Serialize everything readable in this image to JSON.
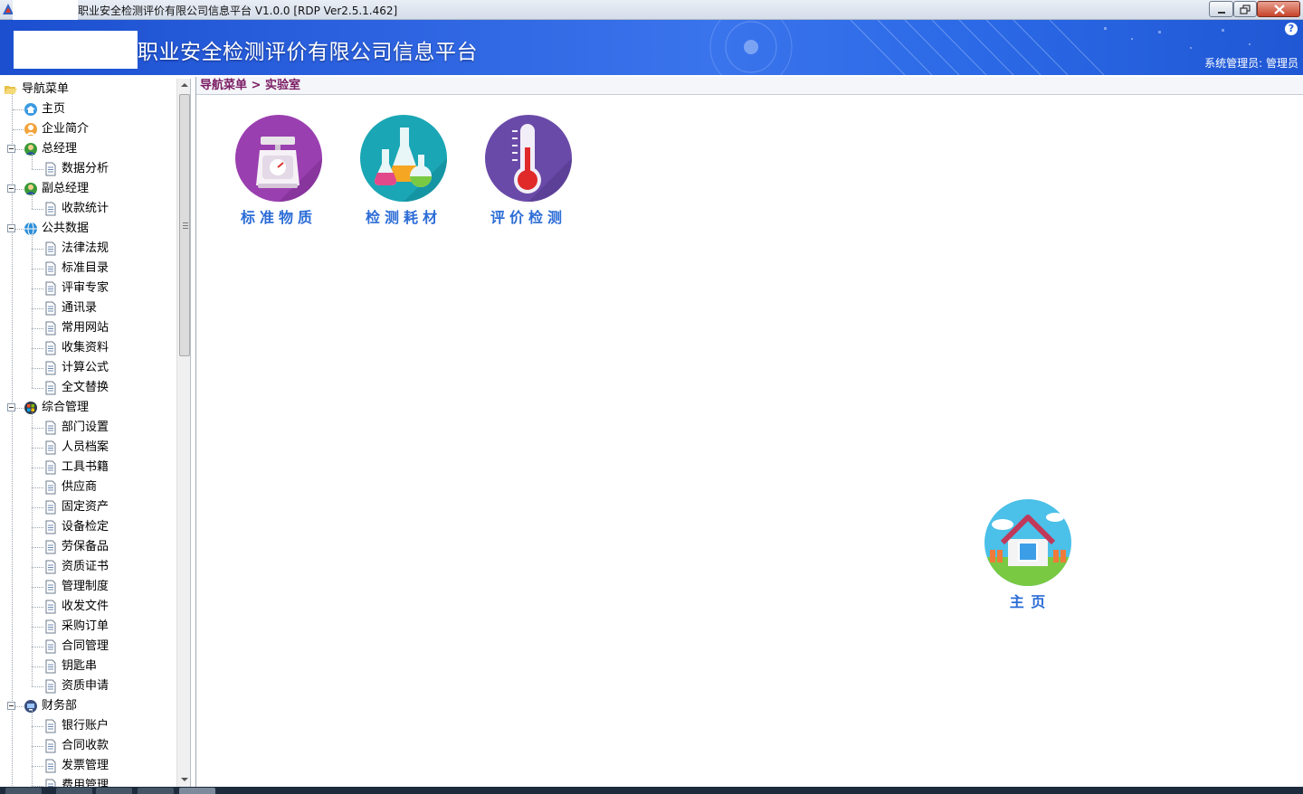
{
  "window": {
    "title": "职业安全检测评价有限公司信息平台 V1.0.0 [RDP Ver2.5.1.462]",
    "controls": [
      "minimize",
      "maximize",
      "close"
    ]
  },
  "header": {
    "title": "职业安全检测评价有限公司信息平台",
    "user": "系统管理员: 管理员",
    "help_icon": "?"
  },
  "sidebar": {
    "root": "导航菜单",
    "items": [
      {
        "label": "主页",
        "level": 1,
        "icon": "home-globe-icon"
      },
      {
        "label": "企业简介",
        "level": 1,
        "icon": "person-icon"
      },
      {
        "label": "总经理",
        "level": 1,
        "icon": "manager-icon",
        "expanded": true
      },
      {
        "label": "数据分析",
        "level": 2,
        "icon": "document-icon"
      },
      {
        "label": "副总经理",
        "level": 1,
        "icon": "manager-icon",
        "expanded": true
      },
      {
        "label": "收款统计",
        "level": 2,
        "icon": "document-icon"
      },
      {
        "label": "公共数据",
        "level": 1,
        "icon": "globe-icon",
        "expanded": true
      },
      {
        "label": "法律法规",
        "level": 2,
        "icon": "document-icon"
      },
      {
        "label": "标准目录",
        "level": 2,
        "icon": "document-icon"
      },
      {
        "label": "评审专家",
        "level": 2,
        "icon": "document-icon"
      },
      {
        "label": "通讯录",
        "level": 2,
        "icon": "document-icon"
      },
      {
        "label": "常用网站",
        "level": 2,
        "icon": "document-icon"
      },
      {
        "label": "收集资料",
        "level": 2,
        "icon": "document-icon"
      },
      {
        "label": "计算公式",
        "level": 2,
        "icon": "document-icon"
      },
      {
        "label": "全文替换",
        "level": 2,
        "icon": "document-icon"
      },
      {
        "label": "综合管理",
        "level": 1,
        "icon": "windows-icon",
        "expanded": true
      },
      {
        "label": "部门设置",
        "level": 2,
        "icon": "document-icon"
      },
      {
        "label": "人员档案",
        "level": 2,
        "icon": "document-icon"
      },
      {
        "label": "工具书籍",
        "level": 2,
        "icon": "document-icon"
      },
      {
        "label": "供应商",
        "level": 2,
        "icon": "document-icon"
      },
      {
        "label": "固定资产",
        "level": 2,
        "icon": "document-icon"
      },
      {
        "label": "设备检定",
        "level": 2,
        "icon": "document-icon"
      },
      {
        "label": "劳保备品",
        "level": 2,
        "icon": "document-icon"
      },
      {
        "label": "资质证书",
        "level": 2,
        "icon": "document-icon"
      },
      {
        "label": "管理制度",
        "level": 2,
        "icon": "document-icon"
      },
      {
        "label": "收发文件",
        "level": 2,
        "icon": "document-icon"
      },
      {
        "label": "采购订单",
        "level": 2,
        "icon": "document-icon"
      },
      {
        "label": "合同管理",
        "level": 2,
        "icon": "document-icon"
      },
      {
        "label": "钥匙串",
        "level": 2,
        "icon": "document-icon"
      },
      {
        "label": "资质申请",
        "level": 2,
        "icon": "document-icon"
      },
      {
        "label": "财务部",
        "level": 1,
        "icon": "monitor-icon",
        "expanded": true
      },
      {
        "label": "银行账户",
        "level": 2,
        "icon": "document-icon"
      },
      {
        "label": "合同收款",
        "level": 2,
        "icon": "document-icon"
      },
      {
        "label": "发票管理",
        "level": 2,
        "icon": "document-icon"
      },
      {
        "label": "费用管理",
        "level": 2,
        "icon": "document-icon"
      }
    ]
  },
  "breadcrumb": {
    "root": "导航菜单",
    "separator": ">",
    "current": "实验室"
  },
  "modules": [
    {
      "label": "标准物质",
      "icon": "scale-icon",
      "color": "#9a3fb0"
    },
    {
      "label": "检测耗材",
      "icon": "flask-icon",
      "color": "#1aa6b5"
    },
    {
      "label": "评价检测",
      "icon": "thermometer-icon",
      "color": "#6a4aa8"
    }
  ],
  "home_button": {
    "label": "主 页",
    "icon": "house-icon"
  },
  "colors": {
    "banner": "#2d63e0",
    "breadcrumb_text": "#7b1c63",
    "module_label": "#2b6cd6"
  }
}
